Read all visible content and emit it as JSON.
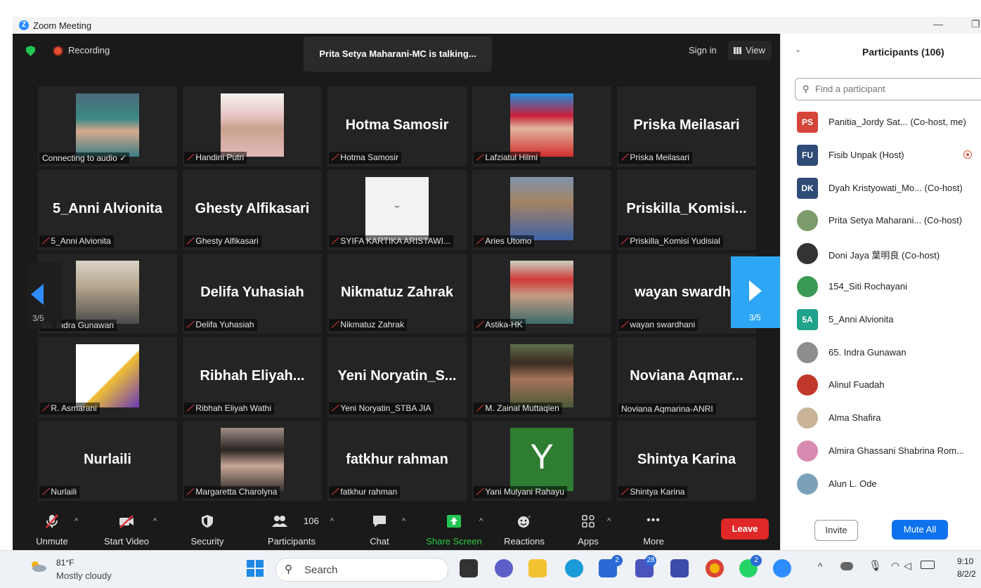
{
  "window": {
    "title": "Zoom Meeting",
    "app_icon": "zoom-logo"
  },
  "meeting": {
    "recording_label": "Recording",
    "talking": "Prita Setya Maharani-MC is talking...",
    "sign_in": "Sign in",
    "view": "View",
    "page_left": "3/5",
    "page_right": "3/5",
    "tiles": [
      {
        "big": "",
        "label": "Connecting to audio ✓",
        "muted": false,
        "photo": "photo-hijab-green"
      },
      {
        "big": "",
        "label": "Handini Putri",
        "muted": true,
        "photo": "photo-hijab-pink"
      },
      {
        "big": "Hotma Samosir",
        "label": "Hotma Samosir",
        "muted": true,
        "photo": ""
      },
      {
        "big": "",
        "label": "Lafziatul Hilmi",
        "muted": true,
        "photo": "photo-hijab-red"
      },
      {
        "big": "Priska Meilasari",
        "label": "Priska Meilasari",
        "muted": true,
        "photo": ""
      },
      {
        "big": "5_Anni Alvionita",
        "label": "5_Anni Alvionita",
        "muted": true,
        "photo": ""
      },
      {
        "big": "Ghesty Alfikasari",
        "label": "Ghesty Alfikasari",
        "muted": true,
        "photo": ""
      },
      {
        "big": "",
        "label": "SYIFA KARTIKA ARISTAWI...",
        "muted": true,
        "photo": "photo-sleepy-face"
      },
      {
        "big": "",
        "label": "Aries Utomo",
        "muted": true,
        "photo": "photo-man-batik"
      },
      {
        "big": "Priskilla_Komisi...",
        "label": "Priskilla_Komisi Yudisial",
        "muted": true,
        "photo": ""
      },
      {
        "big": "",
        "label": "65. Indra Gunawan",
        "muted": false,
        "photo": "photo-man-room"
      },
      {
        "big": "Delifa Yuhasiah",
        "label": "Delifa Yuhasiah",
        "muted": true,
        "photo": ""
      },
      {
        "big": "Nikmatuz Zahrak",
        "label": "Nikmatuz Zahrak",
        "muted": true,
        "photo": ""
      },
      {
        "big": "",
        "label": "Astika-HK",
        "muted": true,
        "photo": "photo-woman-red-hat"
      },
      {
        "big": "wayan swardha",
        "label": "wayan swardhani",
        "muted": true,
        "photo": ""
      },
      {
        "big": "",
        "label": "R. Asmarani",
        "muted": true,
        "photo": "photo-poster"
      },
      {
        "big": "Ribhah Eliyah...",
        "label": "Ribhah Eliyah Wathi",
        "muted": true,
        "photo": ""
      },
      {
        "big": "Yeni Noryatin_S...",
        "label": "Yeni Noryatin_STBA JIA",
        "muted": true,
        "photo": ""
      },
      {
        "big": "",
        "label": "M. Zainal Muttaqien",
        "muted": true,
        "photo": "photo-man-glasses"
      },
      {
        "big": "Noviana Aqmar...",
        "label": "Noviana Aqmarina-ANRI",
        "muted": false,
        "photo": ""
      },
      {
        "big": "Nurlaili",
        "label": "Nurlaili",
        "muted": true,
        "photo": ""
      },
      {
        "big": "",
        "label": "Margaretta Charolyna",
        "muted": true,
        "photo": "photo-woman-glasses"
      },
      {
        "big": "fatkhur rahman",
        "label": "fatkhur rahman",
        "muted": true,
        "photo": ""
      },
      {
        "big": "",
        "label": "Yani Mulyani Rahayu",
        "muted": true,
        "photo": "avatar-y"
      },
      {
        "big": "Shintya Karina",
        "label": "Shintya Karina",
        "muted": true,
        "photo": ""
      }
    ],
    "avatar_letter": "Y",
    "toolbar": {
      "unmute": "Unmute",
      "start_video": "Start Video",
      "security": "Security",
      "participants": "Participants",
      "participants_count": "106",
      "chat": "Chat",
      "share_screen": "Share Screen",
      "reactions": "Reactions",
      "apps": "Apps",
      "more": "More",
      "leave": "Leave"
    }
  },
  "participants_panel": {
    "title": "Participants (106)",
    "search_placeholder": "Find a participant",
    "items": [
      {
        "initials": "PS",
        "color": "#d6453a",
        "name": "Panitia_Jordy Sat... (Co-host, me)",
        "recording": false
      },
      {
        "initials": "FU",
        "color": "#2f4c77",
        "name": "Fisib Unpak (Host)",
        "recording": true
      },
      {
        "initials": "DK",
        "color": "#2f4c77",
        "name": "Dyah Kristyowati_Mo... (Co-host)",
        "recording": false
      },
      {
        "initials": "",
        "color": "#7c9b6a",
        "name": "Prita Setya Maharani... (Co-host)",
        "recording": false
      },
      {
        "initials": "",
        "color": "#333333",
        "name": "Doni Jaya 葉明良 (Co-host)",
        "recording": false
      },
      {
        "initials": "",
        "color": "#3a9a55",
        "name": "154_Siti Rochayani",
        "recording": false
      },
      {
        "initials": "5A",
        "color": "#1fa38a",
        "name": "5_Anni Alvionita",
        "recording": false
      },
      {
        "initials": "",
        "color": "#8d8d8d",
        "name": "65. Indra Gunawan",
        "recording": false
      },
      {
        "initials": "",
        "color": "#c0392b",
        "name": "Alinul Fuadah",
        "recording": false
      },
      {
        "initials": "",
        "color": "#c9b49a",
        "name": "Alma Shafira",
        "recording": false
      },
      {
        "initials": "",
        "color": "#d98ab0",
        "name": "Almira Ghassani Shabrina Rom...",
        "recording": false
      },
      {
        "initials": "",
        "color": "#7aa1b8",
        "name": "Alun L. Ode",
        "recording": false
      }
    ],
    "invite": "Invite",
    "mute_all": "Mute All"
  },
  "taskbar": {
    "weather_temp": "81°F",
    "weather_desc": "Mostly cloudy",
    "search": "Search",
    "time": "9:10",
    "date": "8/2/2",
    "badges": {
      "whatsapp_like": "2",
      "teams": "28",
      "chat": "2"
    }
  }
}
